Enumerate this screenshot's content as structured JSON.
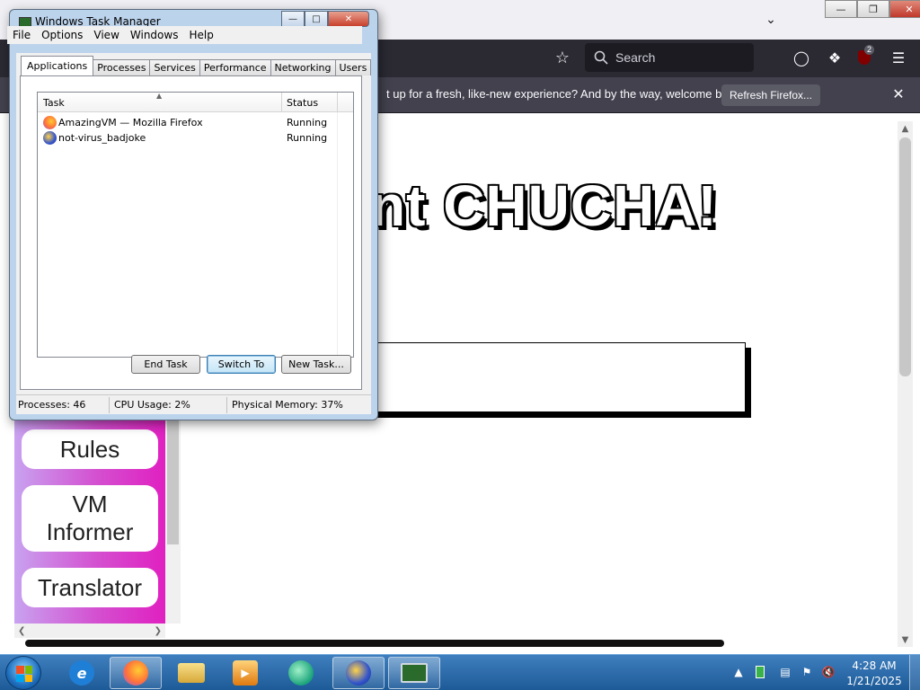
{
  "firefox": {
    "search_placeholder": "Search",
    "notification_text": "t up for a fresh, like-new experience? And by the way, welcome back!",
    "refresh_button": "Refresh Firefox...",
    "extensions_badge": "2",
    "page": {
      "title": "nt CHUCHA!",
      "sidebar_buttons": [
        "Rules",
        "VM Informer",
        "Translator"
      ]
    }
  },
  "task_manager": {
    "title": "Windows Task Manager",
    "menu": [
      "File",
      "Options",
      "View",
      "Windows",
      "Help"
    ],
    "tabs": [
      "Applications",
      "Processes",
      "Services",
      "Performance",
      "Networking",
      "Users"
    ],
    "active_tab": "Applications",
    "columns": {
      "task": "Task",
      "status": "Status"
    },
    "rows": [
      {
        "task": "AmazingVM — Mozilla Firefox",
        "status": "Running",
        "icon": "firefox-icon"
      },
      {
        "task": "not-virus_badjoke",
        "status": "Running",
        "icon": "rocket-icon"
      }
    ],
    "buttons": {
      "end_task": "End Task",
      "switch_to": "Switch To",
      "new_task": "New Task..."
    },
    "status_bar": {
      "processes": "Processes: 46",
      "cpu": "CPU Usage: 2%",
      "memory": "Physical Memory: 37%"
    }
  },
  "taskbar": {
    "time": "4:28 AM",
    "date": "1/21/2025",
    "pinned": [
      "internet-explorer-icon",
      "firefox-icon",
      "explorer-folder-icon",
      "media-player-icon",
      "chat-icon",
      "rocket-icon",
      "task-manager-icon"
    ]
  },
  "colors": {
    "firefox_toolbar": "#2b2a33",
    "sidebar_gradient_end": "#e020c0",
    "taskbar": "#1d5a98"
  }
}
